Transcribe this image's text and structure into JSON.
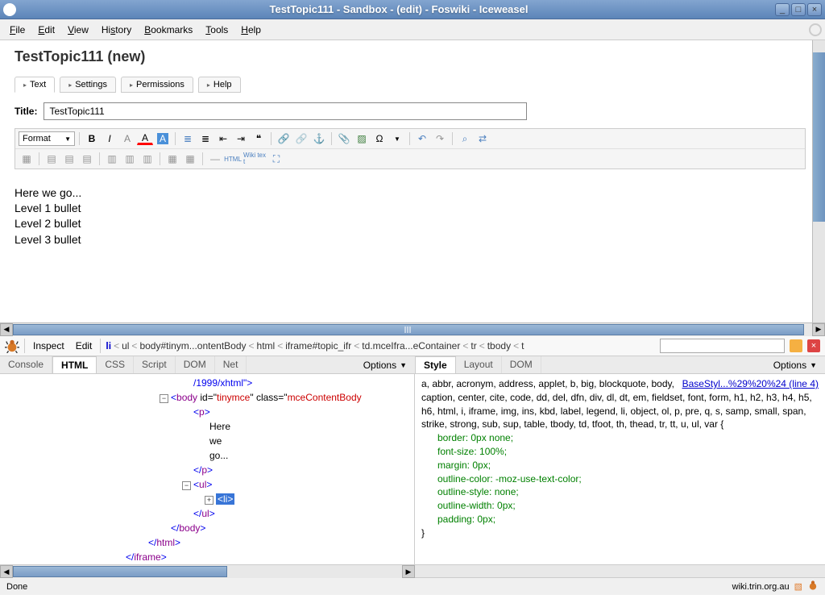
{
  "window": {
    "title": "TestTopic111 - Sandbox - (edit) - Foswiki - Iceweasel"
  },
  "menubar": {
    "file": "File",
    "edit": "Edit",
    "view": "View",
    "history": "History",
    "bookmarks": "Bookmarks",
    "tools": "Tools",
    "help": "Help"
  },
  "page": {
    "title": "TestTopic111 (new)"
  },
  "editTabs": {
    "text": "Text",
    "settings": "Settings",
    "permissions": "Permissions",
    "help": "Help"
  },
  "titleField": {
    "label": "Title:",
    "value": "TestTopic111"
  },
  "formatSelect": "Format",
  "wikiText": "Wiki text",
  "editorContent": {
    "line1": "Here we go...",
    "line2": "Level 1 bullet",
    "line3": "Level 2 bullet",
    "line4": "Level 3 bullet"
  },
  "firebug": {
    "inspect": "Inspect",
    "edit": "Edit",
    "crumbs": {
      "li": "li",
      "ul": "ul",
      "body": "body#tinym...ontentBody",
      "html": "html",
      "iframe": "iframe#topic_ifr",
      "td": "td.mceIfra...eContainer",
      "tr": "tr",
      "tbody": "tbody",
      "t": "t"
    },
    "leftTabs": {
      "console": "Console",
      "html": "HTML",
      "css": "CSS",
      "script": "Script",
      "dom": "DOM",
      "net": "Net"
    },
    "rightTabs": {
      "style": "Style",
      "layout": "Layout",
      "dom": "DOM"
    },
    "options": "Options",
    "htmlTree": {
      "doctype": "/1999/xhtml",
      "body_id": "tinymce",
      "body_class": "mceContentBody",
      "p_text1": "Here",
      "p_text2": "we",
      "p_text3": "go..."
    },
    "cssLink": "BaseStyl...%29%20%24 (line 4)",
    "cssSelectors": "a, abbr, acronym, address, applet, b, big, blockquote, body, caption, center, cite, code, dd, del, dfn, div, dl, dt, em, fieldset, font, form, h1, h2, h3, h4, h5, h6, html, i, iframe, img, ins, kbd, label, legend, li, object, ol, p, pre, q, s, samp, small, span, strike, strong, sub, sup, table, tbody, td, tfoot, th, thead, tr, tt, u, ul, var {",
    "cssProps": {
      "border": "border: 0px none;",
      "fontSize": "font-size: 100%;",
      "margin": "margin: 0px;",
      "outlineColor": "outline-color: -moz-use-text-color;",
      "outlineStyle": "outline-style: none;",
      "outlineWidth": "outline-width: 0px;",
      "padding": "padding: 0px;"
    }
  },
  "statusbar": {
    "left": "Done",
    "host": "wiki.trin.org.au"
  }
}
